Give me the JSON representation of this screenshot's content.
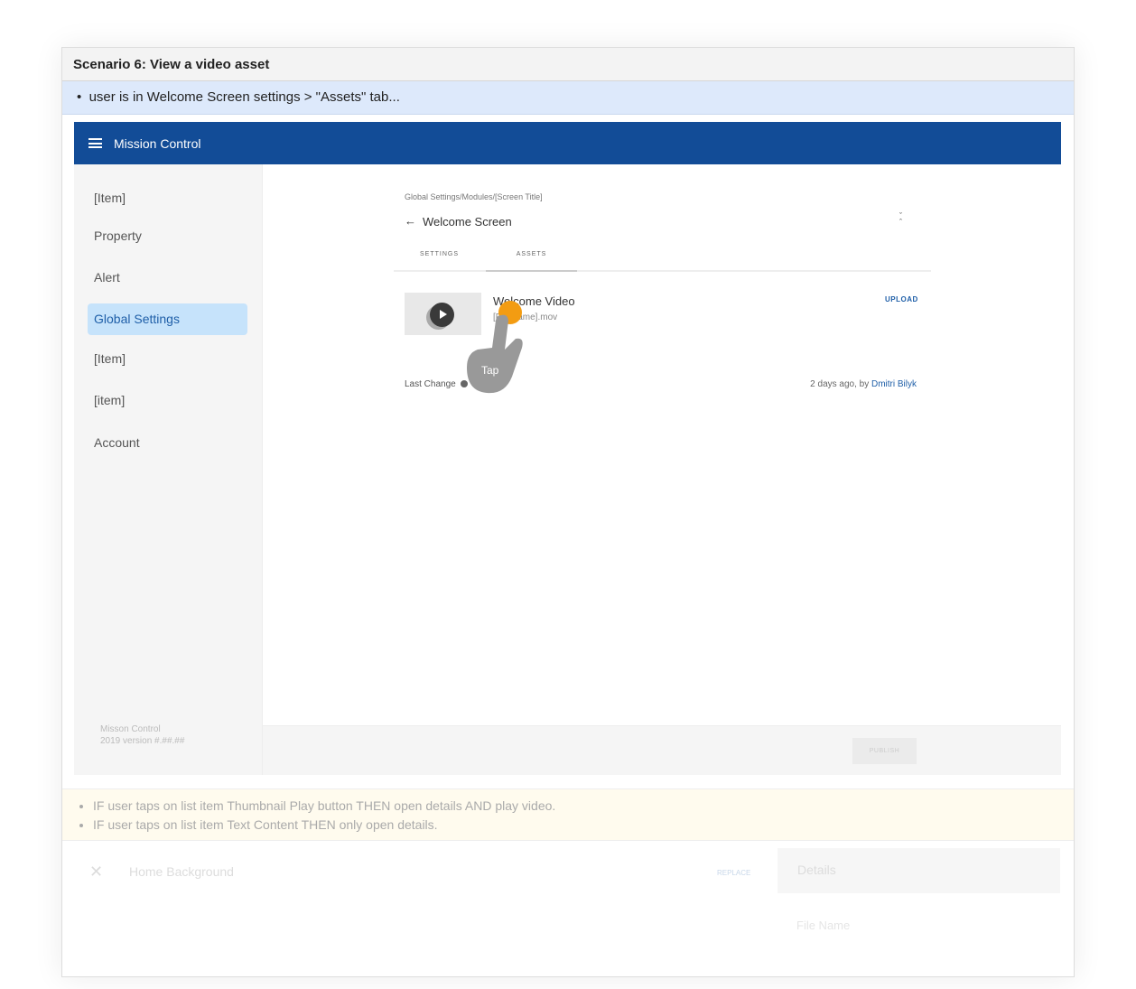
{
  "scenario": {
    "title": "Scenario 6: View a video asset",
    "precondition": "user is in Welcome Screen settings > \"Assets\" tab..."
  },
  "app": {
    "name": "Mission Control",
    "brand_color": "#124c97",
    "version": "Misson Control",
    "version_line": "2019 version #.##.##"
  },
  "sidebar": {
    "items": [
      {
        "label": "[Item]"
      },
      {
        "label": "Property"
      },
      {
        "label": "Alert"
      },
      {
        "label": "Global Settings",
        "active": true
      },
      {
        "label": "[Item]"
      },
      {
        "label": "[item]"
      },
      {
        "label": "Account"
      }
    ]
  },
  "main": {
    "breadcrumb": "Global Settings/Modules/[Screen Title]",
    "back_icon": "arrow-left",
    "title": "Welcome Screen",
    "tabs": [
      {
        "label": "SETTINGS"
      },
      {
        "label": "ASSETS",
        "active": true
      }
    ],
    "asset": {
      "title": "Welcome Video",
      "file": "[File name].mov",
      "upload": "UPLOAD"
    },
    "last_change": {
      "label": "Last Change",
      "value": "2 days ago, by ",
      "user": "Dmitri Bilyk"
    },
    "publish": "PUBLISH",
    "tap_label": "Tap"
  },
  "notes": [
    "IF user taps on list item Thumbnail Play button THEN open details AND play video.",
    "IF user taps on list item Text Content THEN only open details."
  ],
  "next": {
    "title": "Home Background",
    "replace": "REPLACE",
    "details": "Details",
    "file_name": "File Name"
  }
}
